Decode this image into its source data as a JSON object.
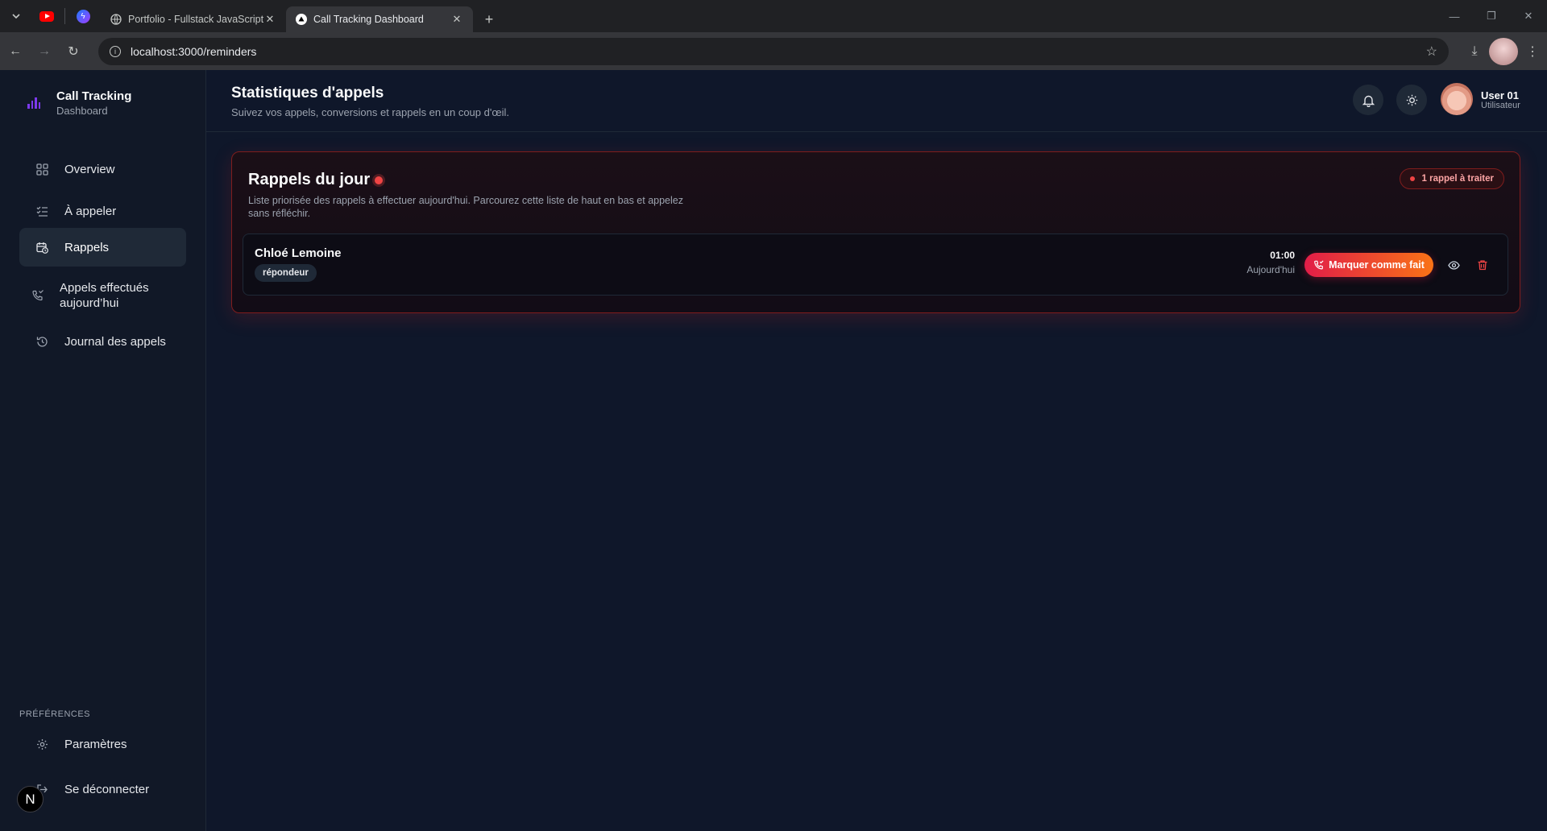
{
  "browser": {
    "tabs": [
      {
        "title": "Portfolio - Fullstack JavaScript D",
        "active": false
      },
      {
        "title": "Call Tracking Dashboard",
        "active": true
      }
    ],
    "url": "localhost:3000/reminders"
  },
  "sidebar": {
    "brand_title": "Call Tracking",
    "brand_sub": "Dashboard",
    "items": [
      {
        "label": "Overview",
        "icon": "grid-icon"
      },
      {
        "label": "À appeler",
        "icon": "list-check-icon"
      },
      {
        "label": "Rappels",
        "icon": "calendar-clock-icon",
        "active": true
      },
      {
        "label": "Appels effectués aujourd’hui",
        "icon": "phone-icon"
      },
      {
        "label": "Journal des appels",
        "icon": "history-icon"
      }
    ],
    "preferences_label": "PRÉFÉRENCES",
    "settings_label": "Paramètres",
    "logout_label": "Se déconnecter",
    "n_badge": "N"
  },
  "header": {
    "title": "Statistiques d'appels",
    "subtitle": "Suivez vos appels, conversions et rappels en un coup d'œil.",
    "user_name": "User 01",
    "user_role": "Utilisateur"
  },
  "reminders": {
    "title": "Rappels du jour",
    "description": "Liste priorisée des rappels à effectuer aujourd'hui. Parcourez cette liste de haut en bas et appelez sans réfléchir.",
    "pill": "1 rappel à traiter",
    "items": [
      {
        "name": "Chloé Lemoine",
        "tag": "répondeur",
        "time": "01:00",
        "day": "Aujourd'hui",
        "action": "Marquer comme fait"
      }
    ]
  },
  "colors": {
    "accent": "#7c3aed",
    "danger": "#ef4444",
    "button_gradient_start": "#e11d48",
    "button_gradient_end": "#f97316"
  }
}
